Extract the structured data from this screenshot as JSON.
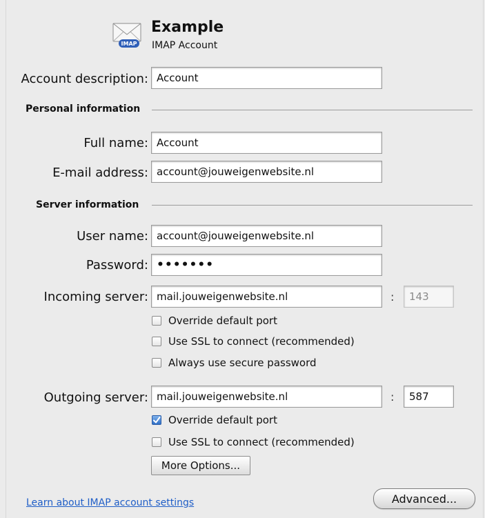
{
  "header": {
    "account_name": "Example",
    "account_type": "IMAP Account",
    "icon_badge": "IMAP",
    "icon": "envelope-icon"
  },
  "account_description": {
    "label": "Account description:",
    "value": "Account"
  },
  "personal_section": {
    "title": "Personal information",
    "full_name": {
      "label": "Full name:",
      "value": "Account"
    },
    "email": {
      "label": "E-mail address:",
      "value": "account@jouweigenwebsite.nl"
    }
  },
  "server_section": {
    "title": "Server information",
    "user_name": {
      "label": "User name:",
      "value": "account@jouweigenwebsite.nl"
    },
    "password": {
      "label": "Password:",
      "value": "•••••••"
    },
    "incoming": {
      "label": "Incoming server:",
      "value": "mail.jouweigenwebsite.nl",
      "port_separator": ":",
      "port": "143",
      "options": [
        {
          "label": "Override default port",
          "checked": false
        },
        {
          "label": "Use SSL to connect (recommended)",
          "checked": false
        },
        {
          "label": "Always use secure password",
          "checked": false
        }
      ]
    },
    "outgoing": {
      "label": "Outgoing server:",
      "value": "mail.jouweigenwebsite.nl",
      "port_separator": ":",
      "port": "587",
      "options": [
        {
          "label": "Override default port",
          "checked": true
        },
        {
          "label": "Use SSL to connect (recommended)",
          "checked": false
        }
      ],
      "more_options_label": "More Options..."
    }
  },
  "footer": {
    "learn_link": "Learn about IMAP account settings",
    "advanced_label": "Advanced..."
  },
  "colors": {
    "link": "#1f5ec7",
    "checkbox_checked": "#2f6fc6",
    "background": "#ebebeb"
  }
}
